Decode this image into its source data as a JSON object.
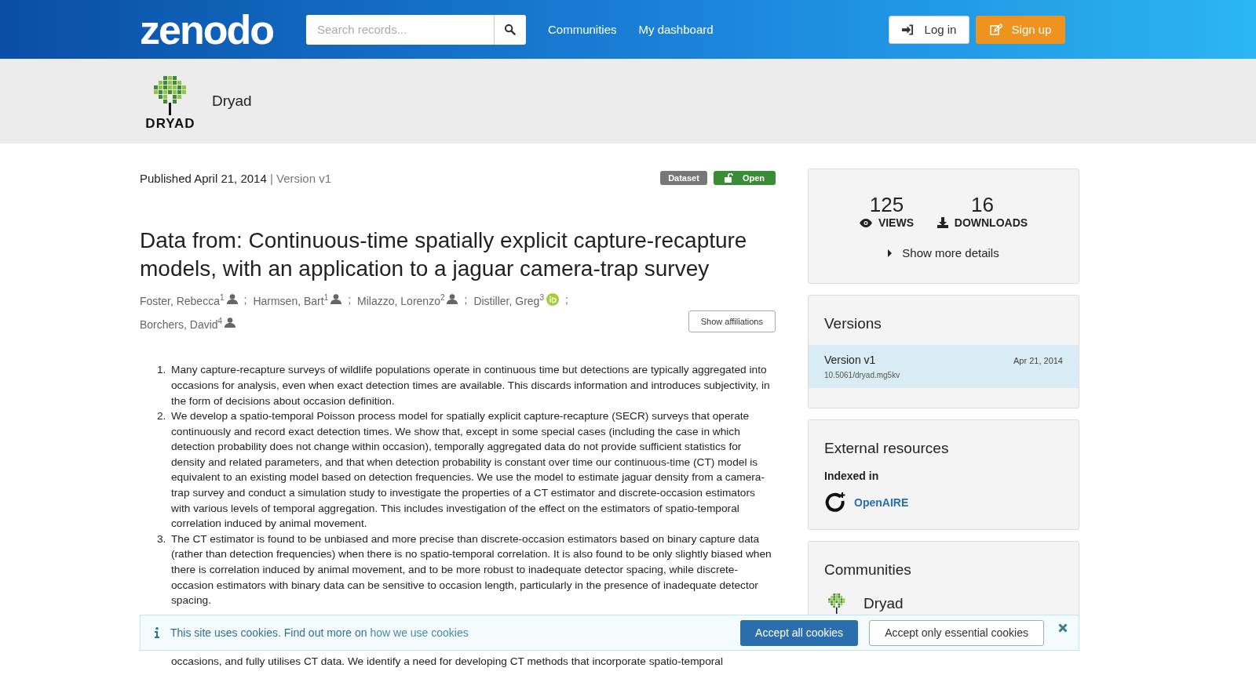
{
  "header": {
    "logo": "zenodo",
    "search": {
      "placeholder": "Search records..."
    },
    "nav": [
      "Communities",
      "My dashboard"
    ],
    "login": "Log in",
    "signup": "Sign up"
  },
  "community_bar": {
    "logo_text": "DRYAD",
    "name": "Dryad"
  },
  "record": {
    "published": "Published April 21, 2014",
    "separator": "|",
    "version": "Version v1",
    "badges": [
      {
        "kind": "type",
        "label": "Dataset"
      },
      {
        "kind": "access",
        "label": "Open"
      }
    ],
    "title": "Data from: Continuous-time spatially explicit capture-recapture models, with an application to a jaguar camera-trap survey",
    "authors": [
      {
        "name": "Foster, Rebecca",
        "affiliation": "1",
        "kind": "person",
        "separator": ";"
      },
      {
        "name": "Harmsen, Bart",
        "affiliation": "1",
        "kind": "person",
        "separator": ";"
      },
      {
        "name": "Milazzo, Lorenzo",
        "affiliation": "2",
        "kind": "person",
        "separator": ";"
      },
      {
        "name": "Distiller, Greg",
        "affiliation": "3",
        "kind": "orcid",
        "separator": ";"
      },
      {
        "name": "Borchers, David",
        "affiliation": "4",
        "kind": "person"
      }
    ],
    "show_affiliations": "Show affiliations",
    "abstract": [
      {
        "number": "1.",
        "lines": [
          "Many capture-recapture surveys of wildlife populations operate in continuous time but detections are typically aggregated into occasions for analysis, even when exact detection times are available. This discards information and introduces subjectivity, in the form of decisions about occasion definition."
        ]
      },
      {
        "number": "2.",
        "lines": [
          "We develop a spatio-temporal Poisson process model for spatially explicit capture-recapture (SECR) surveys that operate continuously and record exact detection times. We show that, except in some special cases (including the case in which detection probability does not change within occasion), temporally aggregated data do not provide sufficient statistics for density and related parameters, and that when detection probability is constant over time our continuous-time (CT) model is equivalent to an existing model based on detection frequencies. We use the model to estimate jaguar density from a camera-trap survey and conduct a simulation study to investigate the properties of a CT estimator and discrete-occasion estimators with various levels of temporal aggregation. This includes investigation of the effect on the estimators of spatio-temporal correlation induced by animal movement."
        ]
      },
      {
        "number": "3.",
        "lines": [
          "The CT estimator is found to be unbiased and more precise than discrete-occasion estimators based on binary capture data (rather than detection frequencies) when there is no spatio-temporal correlation. It is also found to be only slightly biased when there is correlation induced by animal movement, and to be more robust to inadequate detector spacing, while discrete-occasion estimators with binary data can be sensitive to occasion length, particularly in the presence of inadequate detector spacing."
        ]
      },
      {
        "lines": [
          "occasions, and fully utilises CT data. We identify a need for developing CT methods that incorporate spatio-temporal"
        ]
      }
    ]
  },
  "stats": {
    "items": [
      {
        "kind": "views",
        "value": "125",
        "label": "VIEWS"
      },
      {
        "kind": "downloads",
        "value": "16",
        "label": "DOWNLOADS"
      }
    ],
    "more": "Show more details"
  },
  "versions": {
    "title": "Versions",
    "items": [
      {
        "name": "Version v1",
        "date": "Apr 21, 2014",
        "doi": "10.5061/dryad.mg5kv",
        "selected": true
      }
    ]
  },
  "external": {
    "title": "External resources",
    "subtitle": "Indexed in",
    "items": [
      "OpenAIRE"
    ]
  },
  "communities": {
    "title": "Communities",
    "items": [
      {
        "name": "Dryad"
      }
    ]
  },
  "cookie_banner": {
    "text": "This site uses cookies. Find out more on",
    "link": "how we use cookies",
    "accept_all": "Accept all cookies",
    "accept_essential": "Accept only essential cookies"
  }
}
